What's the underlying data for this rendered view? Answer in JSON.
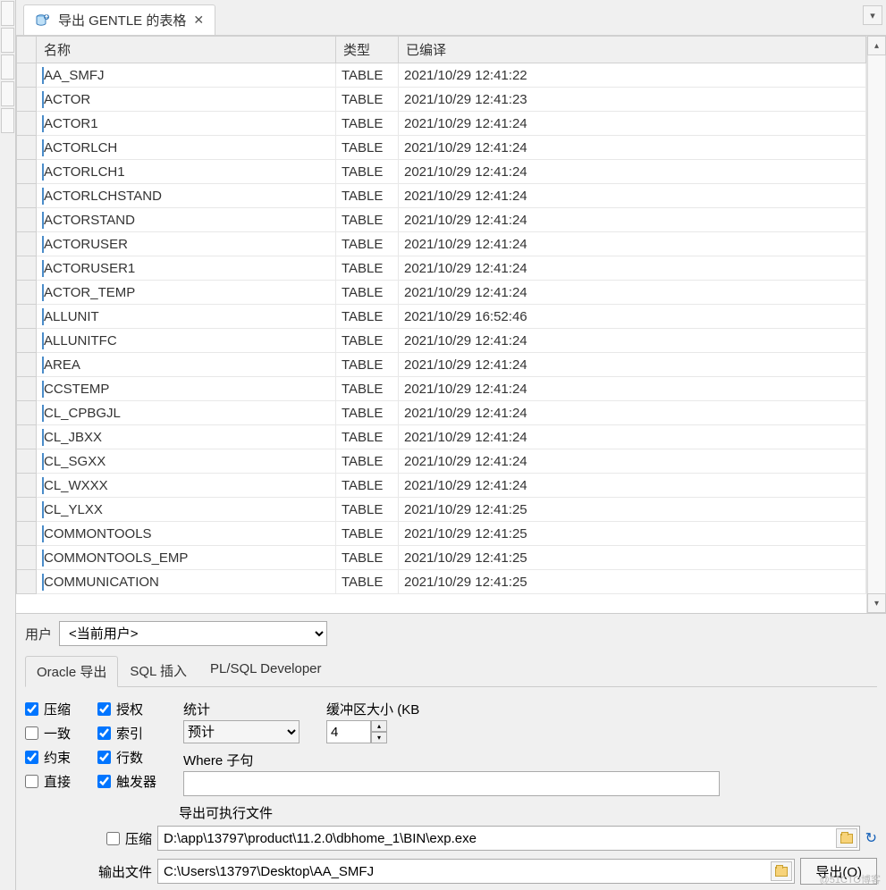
{
  "tab": {
    "title": "导出 GENTLE 的表格"
  },
  "columns": {
    "name": "名称",
    "type": "类型",
    "compiled": "已编译"
  },
  "rows": [
    {
      "name": "AA_SMFJ",
      "type": "TABLE",
      "compiled": "2021/10/29 12:41:22"
    },
    {
      "name": "ACTOR",
      "type": "TABLE",
      "compiled": "2021/10/29 12:41:23"
    },
    {
      "name": "ACTOR1",
      "type": "TABLE",
      "compiled": "2021/10/29 12:41:24"
    },
    {
      "name": "ACTORLCH",
      "type": "TABLE",
      "compiled": "2021/10/29 12:41:24"
    },
    {
      "name": "ACTORLCH1",
      "type": "TABLE",
      "compiled": "2021/10/29 12:41:24"
    },
    {
      "name": "ACTORLCHSTAND",
      "type": "TABLE",
      "compiled": "2021/10/29 12:41:24"
    },
    {
      "name": "ACTORSTAND",
      "type": "TABLE",
      "compiled": "2021/10/29 12:41:24"
    },
    {
      "name": "ACTORUSER",
      "type": "TABLE",
      "compiled": "2021/10/29 12:41:24"
    },
    {
      "name": "ACTORUSER1",
      "type": "TABLE",
      "compiled": "2021/10/29 12:41:24"
    },
    {
      "name": "ACTOR_TEMP",
      "type": "TABLE",
      "compiled": "2021/10/29 12:41:24"
    },
    {
      "name": "ALLUNIT",
      "type": "TABLE",
      "compiled": "2021/10/29 16:52:46"
    },
    {
      "name": "ALLUNITFC",
      "type": "TABLE",
      "compiled": "2021/10/29 12:41:24"
    },
    {
      "name": "AREA",
      "type": "TABLE",
      "compiled": "2021/10/29 12:41:24"
    },
    {
      "name": "CCSTEMP",
      "type": "TABLE",
      "compiled": "2021/10/29 12:41:24"
    },
    {
      "name": "CL_CPBGJL",
      "type": "TABLE",
      "compiled": "2021/10/29 12:41:24"
    },
    {
      "name": "CL_JBXX",
      "type": "TABLE",
      "compiled": "2021/10/29 12:41:24"
    },
    {
      "name": "CL_SGXX",
      "type": "TABLE",
      "compiled": "2021/10/29 12:41:24"
    },
    {
      "name": "CL_WXXX",
      "type": "TABLE",
      "compiled": "2021/10/29 12:41:24"
    },
    {
      "name": "CL_YLXX",
      "type": "TABLE",
      "compiled": "2021/10/29 12:41:25"
    },
    {
      "name": "COMMONTOOLS",
      "type": "TABLE",
      "compiled": "2021/10/29 12:41:25"
    },
    {
      "name": "COMMONTOOLS_EMP",
      "type": "TABLE",
      "compiled": "2021/10/29 12:41:25"
    },
    {
      "name": "COMMUNICATION",
      "type": "TABLE",
      "compiled": "2021/10/29 12:41:25"
    }
  ],
  "user": {
    "label": "用户",
    "value": "<当前用户>"
  },
  "subtabs": {
    "oracle": "Oracle 导出",
    "sql": "SQL 插入",
    "plsql": "PL/SQL Developer"
  },
  "checks_left": {
    "compress": "压缩",
    "consistent": "一致",
    "constraint": "约束",
    "direct": "直接"
  },
  "checks_right": {
    "grant": "授权",
    "index": "索引",
    "rows": "行数",
    "trigger": "触发器"
  },
  "stats": {
    "label": "统计",
    "value": "预计"
  },
  "buffer": {
    "label": "缓冲区大小 (KB",
    "value": "4"
  },
  "where": {
    "label": "Where 子句",
    "value": ""
  },
  "exec": {
    "label": "导出可执行文件",
    "compress": "压缩",
    "path": "D:\\app\\13797\\product\\11.2.0\\dbhome_1\\BIN\\exp.exe"
  },
  "output": {
    "label": "输出文件",
    "path": "C:\\Users\\13797\\Desktop\\AA_SMFJ"
  },
  "export_btn": "导出(O)",
  "watermark": "@51CTO博客"
}
